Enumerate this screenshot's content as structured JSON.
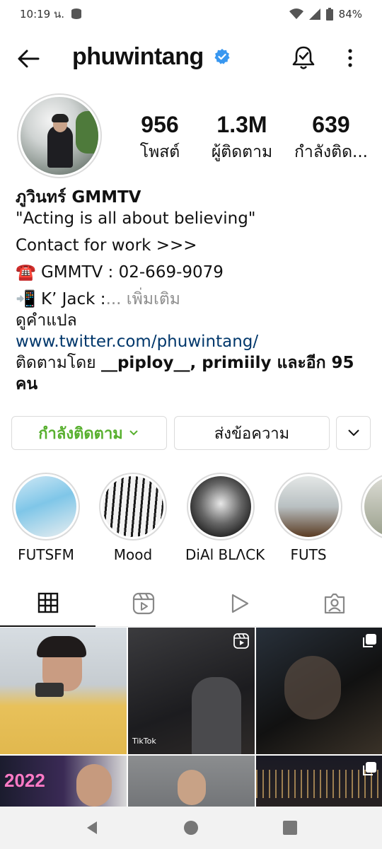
{
  "status_bar": {
    "time": "10:19 น.",
    "battery": "84%"
  },
  "header": {
    "username": "phuwintang",
    "verified": true
  },
  "profile": {
    "stats": [
      {
        "value": "956",
        "label": "โพสต์"
      },
      {
        "value": "1.3M",
        "label": "ผู้ติดตาม"
      },
      {
        "value": "639",
        "label": "กำลังติด..."
      }
    ]
  },
  "bio": {
    "display_name": "ภูวินทร์ GMMTV",
    "quote": "\"Acting is all about believing\"",
    "contact": "Contact for work >>>",
    "phone_line": "☎️ GMMTV  :  02-669-9079",
    "jack_line": "📲  K’ Jack :",
    "more": "... เพิ่มเติม",
    "translate": "ดูคำแปล",
    "link": "www.twitter.com/phuwintang/",
    "followed_by_prefix": "ติดตามโดย ",
    "followed_by_users": "__piploy__, primiily",
    "followed_by_suffix": " และอีก 95",
    "followed_by_tail": "คน"
  },
  "buttons": {
    "following": "กำลังติดตาม",
    "message": "ส่งข้อความ"
  },
  "highlights": [
    {
      "label": "FUTSFM"
    },
    {
      "label": "Mood"
    },
    {
      "label": "DiAl BLΛCK"
    },
    {
      "label": "FUTS"
    },
    {
      "label": ""
    }
  ],
  "tabs": [
    "grid",
    "reels",
    "videos",
    "tagged"
  ],
  "grid": {
    "watermark": "TikTok",
    "year_text": "2022"
  },
  "colors": {
    "accent_green": "#58b02f",
    "link_blue": "#00376b",
    "verified_blue": "#3897f0"
  }
}
